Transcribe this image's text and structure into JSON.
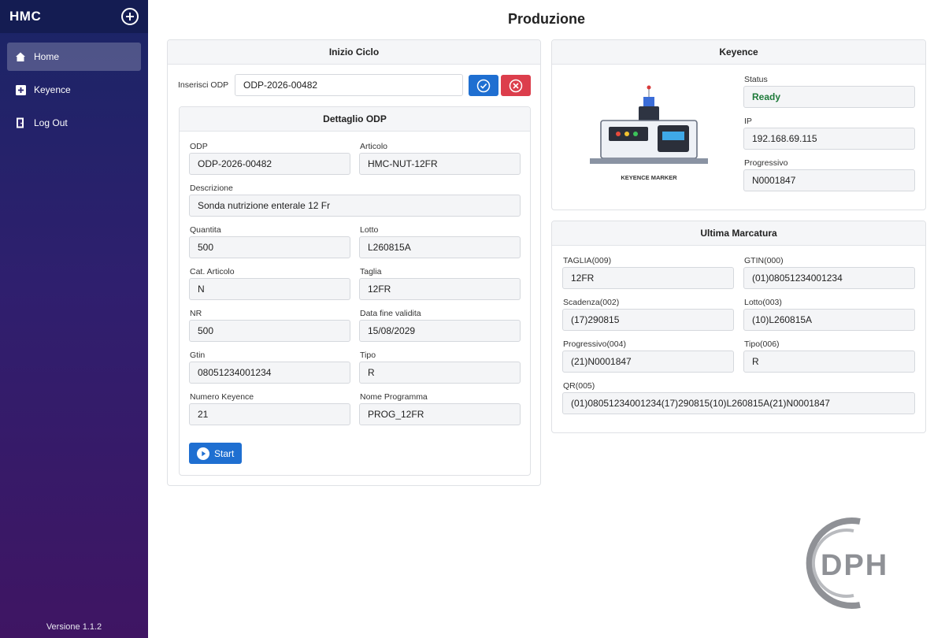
{
  "sidebar": {
    "brand": "HMC",
    "items": [
      {
        "label": "Home",
        "icon": "home-icon"
      },
      {
        "label": "Keyence",
        "icon": "plus-square-icon"
      },
      {
        "label": "Log Out",
        "icon": "door-icon"
      }
    ],
    "version": "Versione 1.1.2"
  },
  "page": {
    "title": "Produzione"
  },
  "inizio": {
    "title": "Inizio Ciclo",
    "odp_label": "Inserisci ODP",
    "odp_value": "ODP-2026-00482"
  },
  "dettaglio": {
    "title": "Dettaglio ODP",
    "fields": {
      "odp": {
        "label": "ODP",
        "value": "ODP-2026-00482"
      },
      "articolo": {
        "label": "Articolo",
        "value": "HMC-NUT-12FR"
      },
      "descrizione": {
        "label": "Descrizione",
        "value": "Sonda nutrizione enterale 12 Fr"
      },
      "quantita": {
        "label": "Quantita",
        "value": "500"
      },
      "lotto": {
        "label": "Lotto",
        "value": "L260815A"
      },
      "cat": {
        "label": "Cat. Articolo",
        "value": "N"
      },
      "taglia": {
        "label": "Taglia",
        "value": "12FR"
      },
      "nr": {
        "label": "NR",
        "value": "500"
      },
      "data": {
        "label": "Data fine validita",
        "value": "15/08/2029"
      },
      "gtin": {
        "label": "Gtin",
        "value": "08051234001234"
      },
      "tipo": {
        "label": "Tipo",
        "value": "R"
      },
      "numero": {
        "label": "Numero Keyence",
        "value": "21"
      },
      "programma": {
        "label": "Nome Programma",
        "value": "PROG_12FR"
      }
    },
    "start_label": "Start"
  },
  "keyence": {
    "title": "Keyence",
    "image_caption": "KEYENCE MARKER",
    "status": {
      "label": "Status",
      "value": "Ready"
    },
    "ip": {
      "label": "IP",
      "value": "192.168.69.115"
    },
    "progressivo": {
      "label": "Progressivo",
      "value": "N0001847"
    }
  },
  "ultima": {
    "title": "Ultima Marcatura",
    "taglia": {
      "label": "TAGLIA(009)",
      "value": "12FR"
    },
    "gtin": {
      "label": "GTIN(000)",
      "value": "(01)08051234001234"
    },
    "scadenza": {
      "label": "Scadenza(002)",
      "value": "(17)290815"
    },
    "lotto": {
      "label": "Lotto(003)",
      "value": "(10)L260815A"
    },
    "progressivo": {
      "label": "Progressivo(004)",
      "value": "(21)N0001847"
    },
    "tipo": {
      "label": "Tipo(006)",
      "value": "R"
    },
    "qr": {
      "label": "QR(005)",
      "value": "(01)08051234001234(17)290815(10)L260815A(21)N0001847"
    }
  },
  "logo": {
    "text": "DPH"
  },
  "colors": {
    "primary": "#1f6fd1",
    "danger": "#dc3e4c",
    "ready": "#1e7a3a"
  }
}
